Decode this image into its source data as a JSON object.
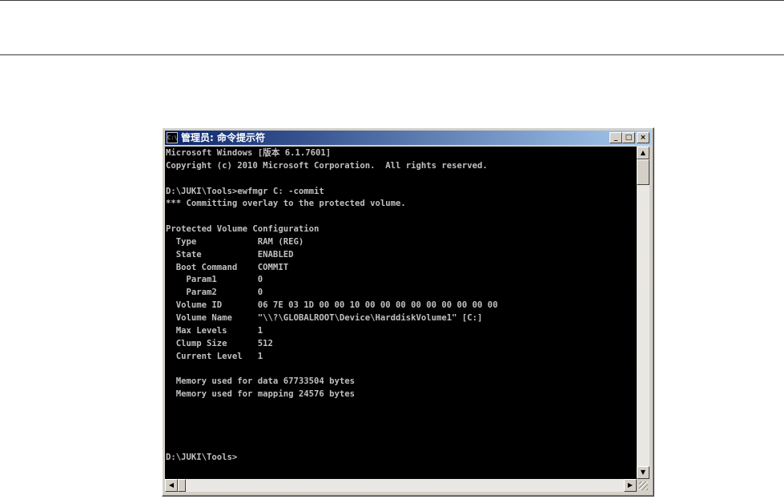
{
  "window": {
    "title": "管理员: 命令提示符",
    "icon_label": "C:\\",
    "buttons": {
      "minimize": "_",
      "maximize": "□",
      "close": "×"
    }
  },
  "console": {
    "lines": [
      "Microsoft Windows [版本 6.1.7601]",
      "Copyright (c) 2010 Microsoft Corporation.  All rights reserved.",
      "",
      "D:\\JUKI\\Tools>ewfmgr C: -commit",
      "*** Committing overlay to the protected volume.",
      "",
      "Protected Volume Configuration",
      "  Type            RAM (REG)",
      "  State           ENABLED",
      "  Boot Command    COMMIT",
      "    Param1        0",
      "    Param2        0",
      "  Volume ID       06 7E 03 1D 00 00 10 00 00 00 00 00 00 00 00 00",
      "  Volume Name     \"\\\\?\\GLOBALROOT\\Device\\HarddiskVolume1\" [C:]",
      "  Max Levels      1",
      "  Clump Size      512",
      "  Current Level   1",
      "",
      "  Memory used for data 67733504 bytes",
      "  Memory used for mapping 24576 bytes",
      "",
      "",
      "",
      "",
      "D:\\JUKI\\Tools>"
    ]
  },
  "scrollbars": {
    "up_arrow": "▲",
    "down_arrow": "▼",
    "left_arrow": "◀",
    "right_arrow": "▶"
  }
}
